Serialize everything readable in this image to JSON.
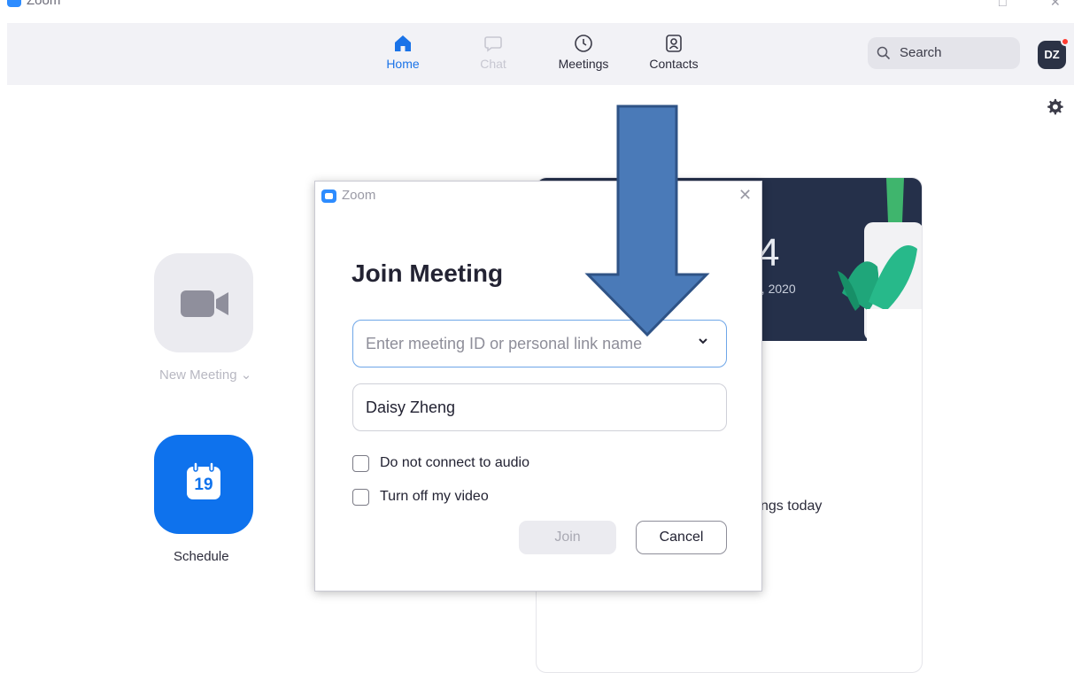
{
  "titlebar": {
    "app_title": "Zoom",
    "minimize_glyph": "□",
    "close_glyph": "✕"
  },
  "nav": {
    "tabs": [
      {
        "label": "Home",
        "icon": "home-icon",
        "state": "active"
      },
      {
        "label": "Chat",
        "icon": "chat-icon",
        "state": "disabled"
      },
      {
        "label": "Meetings",
        "icon": "clock-icon",
        "state": "normal"
      },
      {
        "label": "Contacts",
        "icon": "contacts-icon",
        "state": "normal"
      }
    ],
    "search_label": "Search",
    "avatar_initials": "DZ"
  },
  "home": {
    "new_meeting_label": "New Meeting ⌄",
    "schedule_label": "Schedule",
    "calendar_day": "19"
  },
  "card": {
    "time_fragment": "4",
    "date_fragment": "3, 2020",
    "note_fragment": "ngs today"
  },
  "dialog": {
    "title": "Zoom",
    "close_glyph": "✕",
    "heading": "Join Meeting",
    "meeting_id_placeholder": "Enter meeting ID or personal link name",
    "name_value": "Daisy Zheng",
    "audio_label": "Do not connect to audio",
    "video_label": "Turn off my video",
    "join_label": "Join",
    "cancel_label": "Cancel"
  },
  "colors": {
    "accent": "#0e72ed",
    "nav_bg": "#f2f2f6",
    "arrow_fill": "#4a7ab8",
    "arrow_stroke": "#2f5386",
    "banner_bg": "#25304a"
  }
}
